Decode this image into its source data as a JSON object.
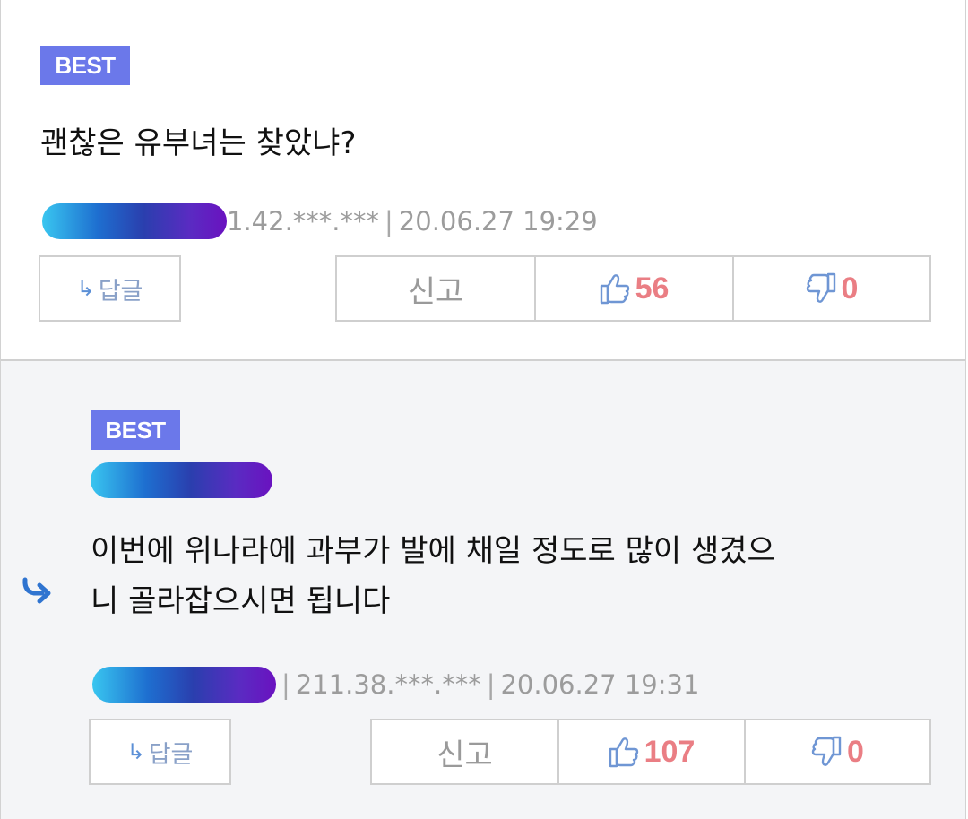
{
  "comments": [
    {
      "badge": "BEST",
      "text_lines": [
        "괜찮은 유부녀는 찾았냐?"
      ],
      "ip": "1.42.***.***",
      "separator": "|",
      "timestamp": "20.06.27 19:29",
      "reply_label": "답글",
      "report_label": "신고",
      "likes": "56",
      "dislikes": "0"
    },
    {
      "badge": "BEST",
      "text_lines": [
        "이번에 위나라에 과부가 발에 채일 정도로 많이 생겼으",
        "니 골라잡으시면 됩니다"
      ],
      "ip": "211.38.***.***",
      "separator": "|",
      "timestamp": "20.06.27 19:31",
      "reply_label": "답글",
      "report_label": "신고",
      "likes": "107",
      "dislikes": "0"
    }
  ],
  "icons": {
    "reply_indicator": "reply-arrow-icon",
    "reply_small": "↳",
    "like": "thumbs-up-icon",
    "dislike": "thumbs-down-icon"
  },
  "colors": {
    "best_badge": "#6b78ea",
    "vote_count": "#ea7e84",
    "reply_arrow": "#2f74d0"
  }
}
